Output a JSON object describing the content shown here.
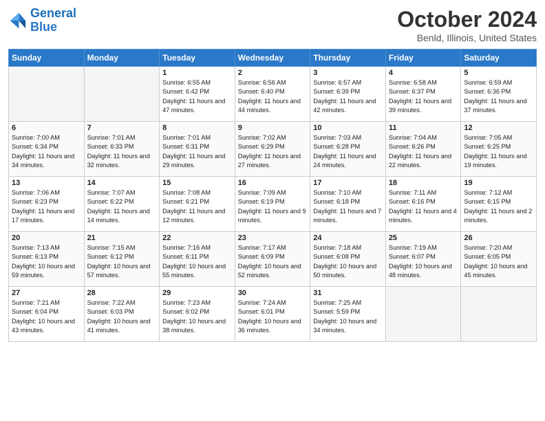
{
  "header": {
    "logo_line1": "General",
    "logo_line2": "Blue",
    "title": "October 2024",
    "subtitle": "Benld, Illinois, United States"
  },
  "weekdays": [
    "Sunday",
    "Monday",
    "Tuesday",
    "Wednesday",
    "Thursday",
    "Friday",
    "Saturday"
  ],
  "weeks": [
    [
      {
        "day": "",
        "empty": true
      },
      {
        "day": "",
        "empty": true
      },
      {
        "day": "1",
        "sunrise": "6:55 AM",
        "sunset": "6:42 PM",
        "daylight": "11 hours and 47 minutes."
      },
      {
        "day": "2",
        "sunrise": "6:56 AM",
        "sunset": "6:40 PM",
        "daylight": "11 hours and 44 minutes."
      },
      {
        "day": "3",
        "sunrise": "6:57 AM",
        "sunset": "6:39 PM",
        "daylight": "11 hours and 42 minutes."
      },
      {
        "day": "4",
        "sunrise": "6:58 AM",
        "sunset": "6:37 PM",
        "daylight": "11 hours and 39 minutes."
      },
      {
        "day": "5",
        "sunrise": "6:59 AM",
        "sunset": "6:36 PM",
        "daylight": "11 hours and 37 minutes."
      }
    ],
    [
      {
        "day": "6",
        "sunrise": "7:00 AM",
        "sunset": "6:34 PM",
        "daylight": "11 hours and 34 minutes."
      },
      {
        "day": "7",
        "sunrise": "7:01 AM",
        "sunset": "6:33 PM",
        "daylight": "11 hours and 32 minutes."
      },
      {
        "day": "8",
        "sunrise": "7:01 AM",
        "sunset": "6:31 PM",
        "daylight": "11 hours and 29 minutes."
      },
      {
        "day": "9",
        "sunrise": "7:02 AM",
        "sunset": "6:29 PM",
        "daylight": "11 hours and 27 minutes."
      },
      {
        "day": "10",
        "sunrise": "7:03 AM",
        "sunset": "6:28 PM",
        "daylight": "11 hours and 24 minutes."
      },
      {
        "day": "11",
        "sunrise": "7:04 AM",
        "sunset": "6:26 PM",
        "daylight": "11 hours and 22 minutes."
      },
      {
        "day": "12",
        "sunrise": "7:05 AM",
        "sunset": "6:25 PM",
        "daylight": "11 hours and 19 minutes."
      }
    ],
    [
      {
        "day": "13",
        "sunrise": "7:06 AM",
        "sunset": "6:23 PM",
        "daylight": "11 hours and 17 minutes."
      },
      {
        "day": "14",
        "sunrise": "7:07 AM",
        "sunset": "6:22 PM",
        "daylight": "11 hours and 14 minutes."
      },
      {
        "day": "15",
        "sunrise": "7:08 AM",
        "sunset": "6:21 PM",
        "daylight": "11 hours and 12 minutes."
      },
      {
        "day": "16",
        "sunrise": "7:09 AM",
        "sunset": "6:19 PM",
        "daylight": "11 hours and 9 minutes."
      },
      {
        "day": "17",
        "sunrise": "7:10 AM",
        "sunset": "6:18 PM",
        "daylight": "11 hours and 7 minutes."
      },
      {
        "day": "18",
        "sunrise": "7:11 AM",
        "sunset": "6:16 PM",
        "daylight": "11 hours and 4 minutes."
      },
      {
        "day": "19",
        "sunrise": "7:12 AM",
        "sunset": "6:15 PM",
        "daylight": "11 hours and 2 minutes."
      }
    ],
    [
      {
        "day": "20",
        "sunrise": "7:13 AM",
        "sunset": "6:13 PM",
        "daylight": "10 hours and 59 minutes."
      },
      {
        "day": "21",
        "sunrise": "7:15 AM",
        "sunset": "6:12 PM",
        "daylight": "10 hours and 57 minutes."
      },
      {
        "day": "22",
        "sunrise": "7:16 AM",
        "sunset": "6:11 PM",
        "daylight": "10 hours and 55 minutes."
      },
      {
        "day": "23",
        "sunrise": "7:17 AM",
        "sunset": "6:09 PM",
        "daylight": "10 hours and 52 minutes."
      },
      {
        "day": "24",
        "sunrise": "7:18 AM",
        "sunset": "6:08 PM",
        "daylight": "10 hours and 50 minutes."
      },
      {
        "day": "25",
        "sunrise": "7:19 AM",
        "sunset": "6:07 PM",
        "daylight": "10 hours and 48 minutes."
      },
      {
        "day": "26",
        "sunrise": "7:20 AM",
        "sunset": "6:05 PM",
        "daylight": "10 hours and 45 minutes."
      }
    ],
    [
      {
        "day": "27",
        "sunrise": "7:21 AM",
        "sunset": "6:04 PM",
        "daylight": "10 hours and 43 minutes."
      },
      {
        "day": "28",
        "sunrise": "7:22 AM",
        "sunset": "6:03 PM",
        "daylight": "10 hours and 41 minutes."
      },
      {
        "day": "29",
        "sunrise": "7:23 AM",
        "sunset": "6:02 PM",
        "daylight": "10 hours and 38 minutes."
      },
      {
        "day": "30",
        "sunrise": "7:24 AM",
        "sunset": "6:01 PM",
        "daylight": "10 hours and 36 minutes."
      },
      {
        "day": "31",
        "sunrise": "7:25 AM",
        "sunset": "5:59 PM",
        "daylight": "10 hours and 34 minutes."
      },
      {
        "day": "",
        "empty": true
      },
      {
        "day": "",
        "empty": true
      }
    ]
  ],
  "labels": {
    "sunrise_prefix": "Sunrise: ",
    "sunset_prefix": "Sunset: ",
    "daylight_prefix": "Daylight: "
  }
}
